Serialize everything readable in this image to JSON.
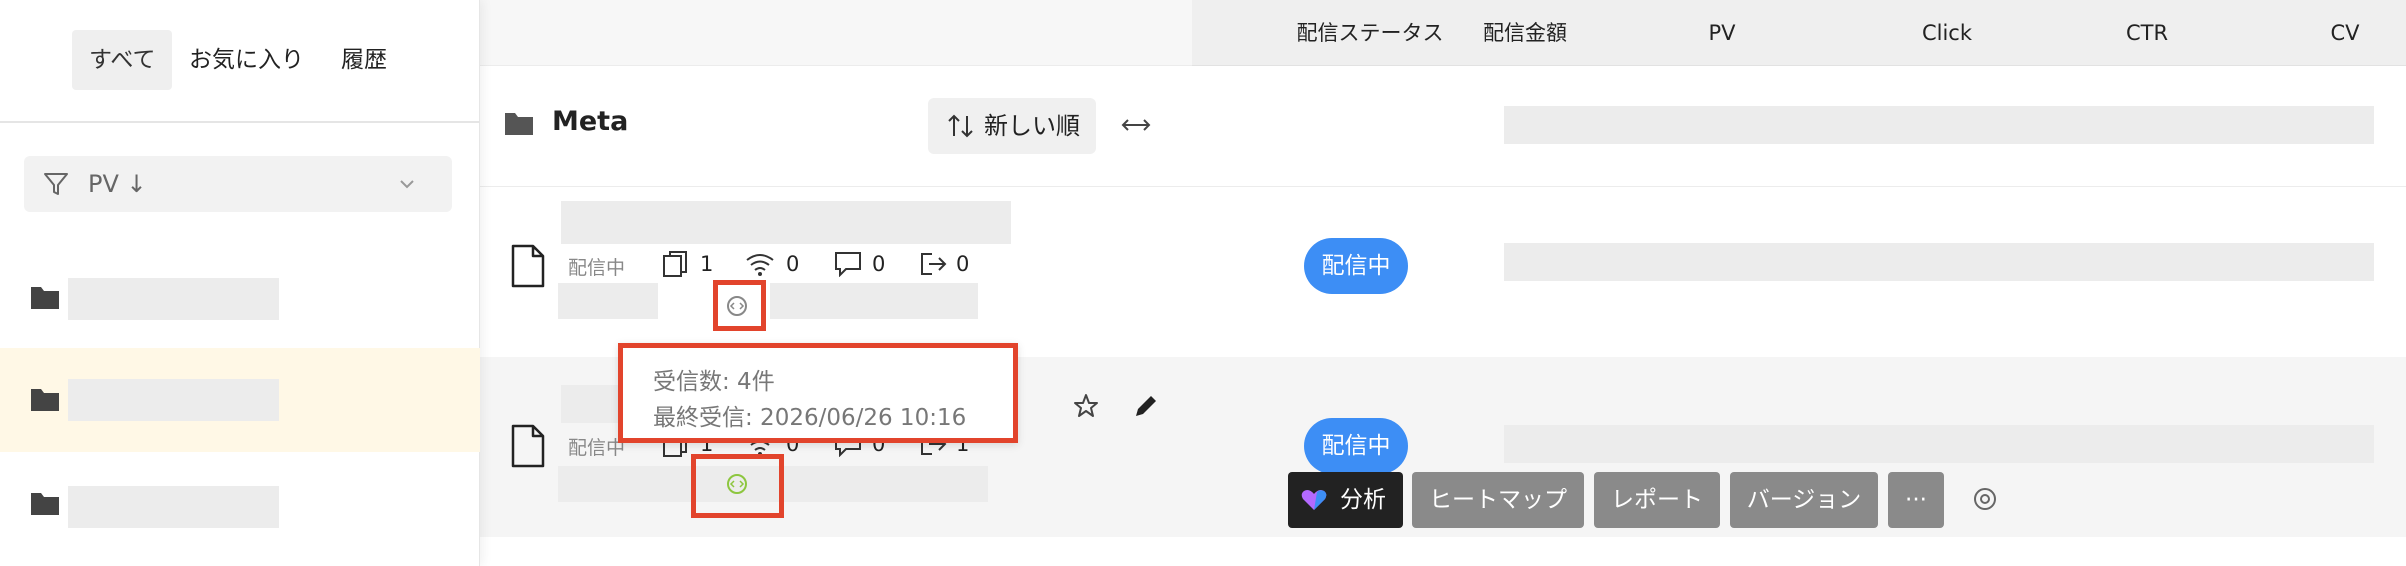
{
  "sidebar": {
    "tabs": [
      "すべて",
      "お気に入り",
      "履歴"
    ],
    "filter": {
      "label": "PV ↓"
    }
  },
  "list": {
    "folder_title": "Meta",
    "sort_label": "新しい順",
    "rows": [
      {
        "status_text": "配信中",
        "counts": [
          "1",
          "0",
          "0",
          "0"
        ]
      },
      {
        "status_text": "配信中",
        "counts": [
          "1",
          "0",
          "0",
          "1"
        ]
      }
    ]
  },
  "table": {
    "columns": [
      "配信ステータス",
      "配信金額",
      "PV",
      "Click",
      "CTR",
      "CV"
    ],
    "row_badges": [
      "配信中",
      "配信中"
    ]
  },
  "tooltip": {
    "received_count": "受信数: 4件",
    "last_received": "最終受信: 2026/06/26 10:16"
  },
  "actions": {
    "analyze": "分析",
    "heatmap": "ヒートマップ",
    "report": "レポート",
    "version": "バージョン",
    "more": "···"
  },
  "colors": {
    "accent_blue": "#3d8ef5",
    "highlight_red": "#e2442c",
    "selected_row": "#fff8e6",
    "active_green": "#8dc63f"
  },
  "icons": [
    "filter-icon",
    "chevron-down-icon",
    "folder-icon",
    "sort-icon",
    "expand-icon",
    "document-icon",
    "copy-icon",
    "wifi-icon",
    "comment-icon",
    "exit-icon",
    "code-circle-icon",
    "star-icon",
    "pencil-icon",
    "gear-icon",
    "heart-logo-icon"
  ]
}
